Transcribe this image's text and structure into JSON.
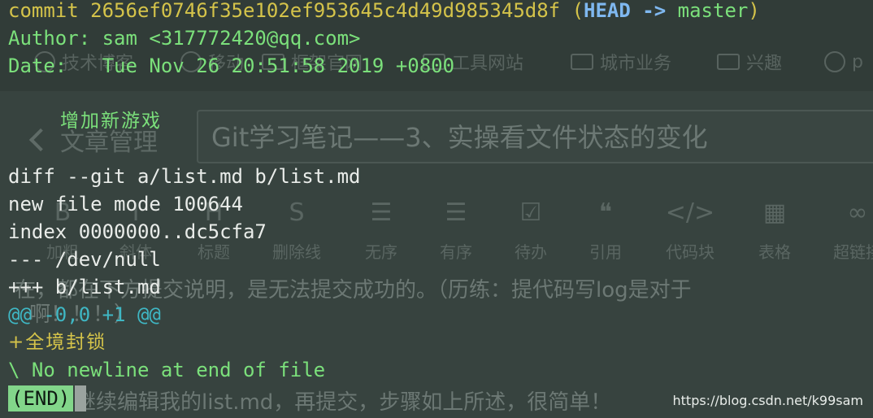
{
  "background": {
    "bookmarks": [
      {
        "label": "技术博客",
        "icon": "globe-icon"
      },
      {
        "label": "移动",
        "icon": "globe-icon"
      },
      {
        "label": "框架官网",
        "icon": "folder-icon"
      },
      {
        "label": "工具网站",
        "icon": "folder-icon"
      },
      {
        "label": "城市业务",
        "icon": "folder-icon"
      },
      {
        "label": "兴趣",
        "icon": "folder-icon"
      },
      {
        "label": "p",
        "icon": "avatar-icon"
      }
    ],
    "back_label": "文章管理",
    "article_title": "Git学习笔记——3、实操看文件状态的变化",
    "toolbar": [
      {
        "icon": "B",
        "label": "加粗"
      },
      {
        "icon": "I",
        "label": "斜体"
      },
      {
        "icon": "H",
        "label": "标题"
      },
      {
        "icon": "S",
        "label": "删除线"
      },
      {
        "icon": "☰",
        "label": "无序"
      },
      {
        "icon": "☰",
        "label": "有序"
      },
      {
        "icon": "☑",
        "label": "待办"
      },
      {
        "icon": "❝",
        "label": "引用"
      },
      {
        "icon": "</>",
        "label": "代码块"
      },
      {
        "icon": "▦",
        "label": "表格"
      },
      {
        "icon": "∞",
        "label": "超链接"
      }
    ],
    "article_lines": [
      "在，都在下方提交说明，是无法提交成功的。（历练：提代码写log是对于",
      "啊！！！）",
      "五、继续编辑我的list.md，再提交，步骤如上所述，很简单！"
    ],
    "watermark": "https://blog.csdn.net/k99sam"
  },
  "terminal": {
    "commit_label": "commit",
    "commit_hash": "2656ef0746f35e102ef953645c4d49d985345d8f",
    "head_ref": "HEAD",
    "arrow": "->",
    "branch": "master",
    "author_line": "Author: sam <317772420@qq.com>",
    "date_line": "Date:   Tue Nov 26 20:51:58 2019 +0800",
    "message": "增加新游戏",
    "diff_lines": [
      "diff --git a/list.md b/list.md",
      "new file mode 100644",
      "index 0000000..dc5cfa7",
      "--- /dev/null",
      "+++ b/list.md"
    ],
    "hunk_header": "@@ -0,0 +1 @@",
    "added_line": "+全境封锁",
    "no_newline": "\\ No newline at end of file",
    "pager_status": "(END)"
  },
  "colors": {
    "commit": "#d4c34a",
    "meta": "#7be07b",
    "hunk": "#3fb7c4",
    "end_badge": "#82d68a"
  }
}
